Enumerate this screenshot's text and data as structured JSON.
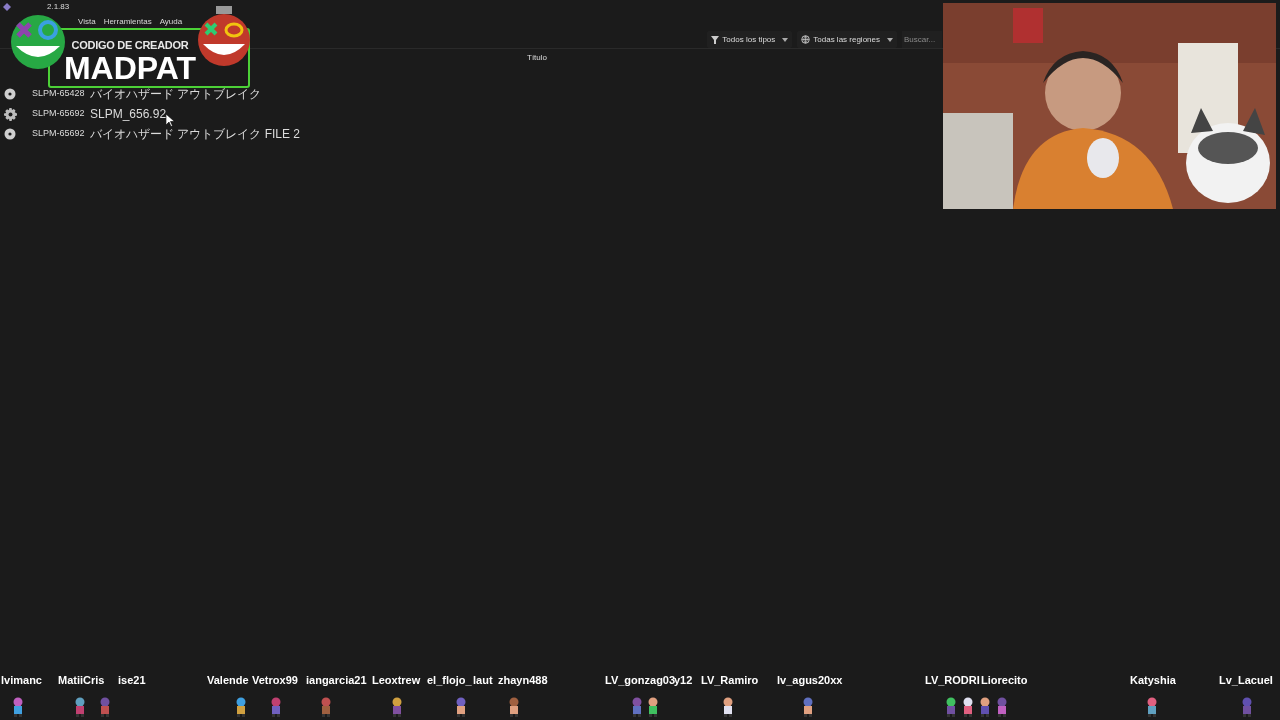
{
  "window": {
    "title": "2.1.83"
  },
  "menu": [
    "Vista",
    "Herramientas",
    "Ayuda"
  ],
  "toolbar": {
    "type_filter": "Todos los tipos",
    "region_filter": "Todas las regiones",
    "search": {
      "placeholder": "Buscar..."
    }
  },
  "table": {
    "columns": [
      "Título"
    ],
    "rows": [
      {
        "kind": "disc",
        "serial": "SLPM-65428",
        "title": "バイオハザード アウトブレイク"
      },
      {
        "kind": "gear",
        "serial": "SLPM-65692",
        "title": "SLPM_656.92"
      },
      {
        "kind": "disc",
        "serial": "SLPM-65692",
        "title": "バイオハザード アウトブレイク FILE 2"
      }
    ]
  },
  "overlay": {
    "label": "CODIGO DE CREADOR",
    "name": "MADPAT"
  },
  "chatters": [
    "lvimanc",
    "MatiiCris",
    "ise21",
    "Valende",
    "Vetrox99",
    "iangarcia21",
    "Leoxtrew",
    "el_flojo_",
    "laut",
    "zhayn488",
    "LV_gonzag03",
    "y12",
    "LV_Ramiro",
    "lv_agus20xx",
    "LV_RODRI",
    "Liorecito",
    "Katyshia",
    "Lv_LacueI"
  ]
}
